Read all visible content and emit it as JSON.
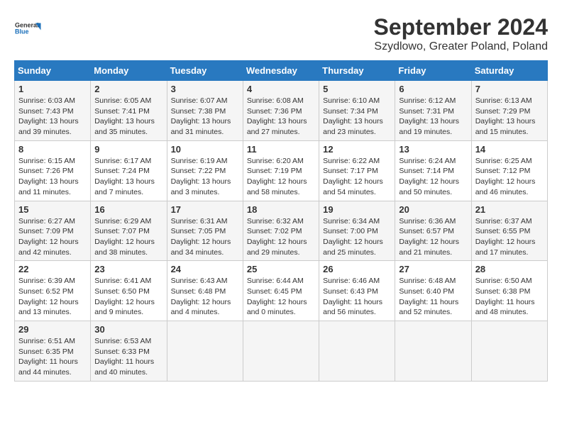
{
  "header": {
    "logo_line1": "General",
    "logo_line2": "Blue",
    "month_year": "September 2024",
    "location": "Szydlowo, Greater Poland, Poland"
  },
  "columns": [
    "Sunday",
    "Monday",
    "Tuesday",
    "Wednesday",
    "Thursday",
    "Friday",
    "Saturday"
  ],
  "weeks": [
    [
      {
        "day": "1",
        "sunrise": "Sunrise: 6:03 AM",
        "sunset": "Sunset: 7:43 PM",
        "daylight": "Daylight: 13 hours and 39 minutes."
      },
      {
        "day": "2",
        "sunrise": "Sunrise: 6:05 AM",
        "sunset": "Sunset: 7:41 PM",
        "daylight": "Daylight: 13 hours and 35 minutes."
      },
      {
        "day": "3",
        "sunrise": "Sunrise: 6:07 AM",
        "sunset": "Sunset: 7:38 PM",
        "daylight": "Daylight: 13 hours and 31 minutes."
      },
      {
        "day": "4",
        "sunrise": "Sunrise: 6:08 AM",
        "sunset": "Sunset: 7:36 PM",
        "daylight": "Daylight: 13 hours and 27 minutes."
      },
      {
        "day": "5",
        "sunrise": "Sunrise: 6:10 AM",
        "sunset": "Sunset: 7:34 PM",
        "daylight": "Daylight: 13 hours and 23 minutes."
      },
      {
        "day": "6",
        "sunrise": "Sunrise: 6:12 AM",
        "sunset": "Sunset: 7:31 PM",
        "daylight": "Daylight: 13 hours and 19 minutes."
      },
      {
        "day": "7",
        "sunrise": "Sunrise: 6:13 AM",
        "sunset": "Sunset: 7:29 PM",
        "daylight": "Daylight: 13 hours and 15 minutes."
      }
    ],
    [
      {
        "day": "8",
        "sunrise": "Sunrise: 6:15 AM",
        "sunset": "Sunset: 7:26 PM",
        "daylight": "Daylight: 13 hours and 11 minutes."
      },
      {
        "day": "9",
        "sunrise": "Sunrise: 6:17 AM",
        "sunset": "Sunset: 7:24 PM",
        "daylight": "Daylight: 13 hours and 7 minutes."
      },
      {
        "day": "10",
        "sunrise": "Sunrise: 6:19 AM",
        "sunset": "Sunset: 7:22 PM",
        "daylight": "Daylight: 13 hours and 3 minutes."
      },
      {
        "day": "11",
        "sunrise": "Sunrise: 6:20 AM",
        "sunset": "Sunset: 7:19 PM",
        "daylight": "Daylight: 12 hours and 58 minutes."
      },
      {
        "day": "12",
        "sunrise": "Sunrise: 6:22 AM",
        "sunset": "Sunset: 7:17 PM",
        "daylight": "Daylight: 12 hours and 54 minutes."
      },
      {
        "day": "13",
        "sunrise": "Sunrise: 6:24 AM",
        "sunset": "Sunset: 7:14 PM",
        "daylight": "Daylight: 12 hours and 50 minutes."
      },
      {
        "day": "14",
        "sunrise": "Sunrise: 6:25 AM",
        "sunset": "Sunset: 7:12 PM",
        "daylight": "Daylight: 12 hours and 46 minutes."
      }
    ],
    [
      {
        "day": "15",
        "sunrise": "Sunrise: 6:27 AM",
        "sunset": "Sunset: 7:09 PM",
        "daylight": "Daylight: 12 hours and 42 minutes."
      },
      {
        "day": "16",
        "sunrise": "Sunrise: 6:29 AM",
        "sunset": "Sunset: 7:07 PM",
        "daylight": "Daylight: 12 hours and 38 minutes."
      },
      {
        "day": "17",
        "sunrise": "Sunrise: 6:31 AM",
        "sunset": "Sunset: 7:05 PM",
        "daylight": "Daylight: 12 hours and 34 minutes."
      },
      {
        "day": "18",
        "sunrise": "Sunrise: 6:32 AM",
        "sunset": "Sunset: 7:02 PM",
        "daylight": "Daylight: 12 hours and 29 minutes."
      },
      {
        "day": "19",
        "sunrise": "Sunrise: 6:34 AM",
        "sunset": "Sunset: 7:00 PM",
        "daylight": "Daylight: 12 hours and 25 minutes."
      },
      {
        "day": "20",
        "sunrise": "Sunrise: 6:36 AM",
        "sunset": "Sunset: 6:57 PM",
        "daylight": "Daylight: 12 hours and 21 minutes."
      },
      {
        "day": "21",
        "sunrise": "Sunrise: 6:37 AM",
        "sunset": "Sunset: 6:55 PM",
        "daylight": "Daylight: 12 hours and 17 minutes."
      }
    ],
    [
      {
        "day": "22",
        "sunrise": "Sunrise: 6:39 AM",
        "sunset": "Sunset: 6:52 PM",
        "daylight": "Daylight: 12 hours and 13 minutes."
      },
      {
        "day": "23",
        "sunrise": "Sunrise: 6:41 AM",
        "sunset": "Sunset: 6:50 PM",
        "daylight": "Daylight: 12 hours and 9 minutes."
      },
      {
        "day": "24",
        "sunrise": "Sunrise: 6:43 AM",
        "sunset": "Sunset: 6:48 PM",
        "daylight": "Daylight: 12 hours and 4 minutes."
      },
      {
        "day": "25",
        "sunrise": "Sunrise: 6:44 AM",
        "sunset": "Sunset: 6:45 PM",
        "daylight": "Daylight: 12 hours and 0 minutes."
      },
      {
        "day": "26",
        "sunrise": "Sunrise: 6:46 AM",
        "sunset": "Sunset: 6:43 PM",
        "daylight": "Daylight: 11 hours and 56 minutes."
      },
      {
        "day": "27",
        "sunrise": "Sunrise: 6:48 AM",
        "sunset": "Sunset: 6:40 PM",
        "daylight": "Daylight: 11 hours and 52 minutes."
      },
      {
        "day": "28",
        "sunrise": "Sunrise: 6:50 AM",
        "sunset": "Sunset: 6:38 PM",
        "daylight": "Daylight: 11 hours and 48 minutes."
      }
    ],
    [
      {
        "day": "29",
        "sunrise": "Sunrise: 6:51 AM",
        "sunset": "Sunset: 6:35 PM",
        "daylight": "Daylight: 11 hours and 44 minutes."
      },
      {
        "day": "30",
        "sunrise": "Sunrise: 6:53 AM",
        "sunset": "Sunset: 6:33 PM",
        "daylight": "Daylight: 11 hours and 40 minutes."
      },
      null,
      null,
      null,
      null,
      null
    ]
  ]
}
